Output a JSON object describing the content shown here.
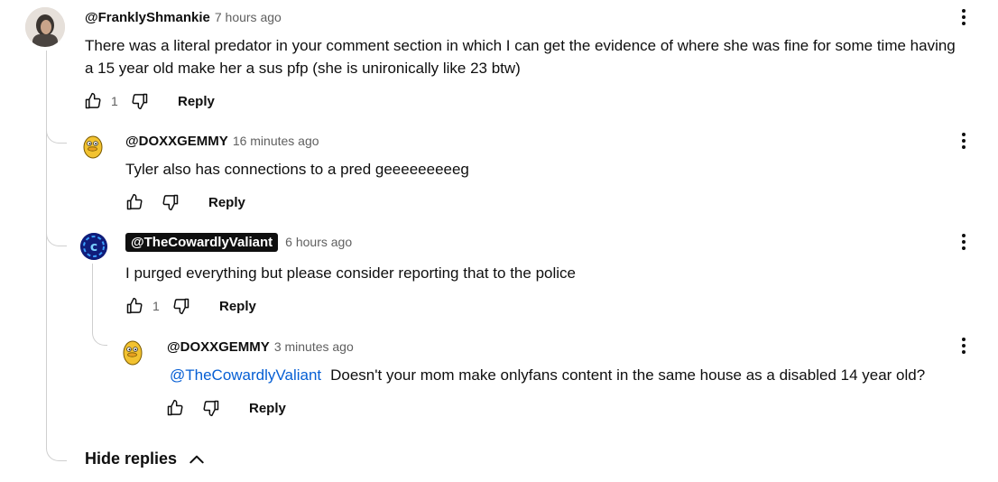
{
  "comments": [
    {
      "handle": "@FranklyShmankie",
      "time": "7 hours ago",
      "text_line1": "There was a literal predator in your comment section in which I can get the evidence of where she was fine for some time having",
      "text_line2": "a 15 year old make her a sus pfp (she is unironically like 23 btw)",
      "likes": "1",
      "reply_label": "Reply"
    },
    {
      "handle": "@DOXXGEMMY",
      "time": "16 minutes ago",
      "text": "Tyler also has connections to a pred geeeeeeeeeg",
      "likes": "",
      "reply_label": "Reply"
    },
    {
      "handle": "@TheCowardlyValiant",
      "time": "6 hours ago",
      "text": "I purged everything but please consider reporting that to the police",
      "likes": "1",
      "reply_label": "Reply"
    },
    {
      "handle": "@DOXXGEMMY",
      "time": "3 minutes ago",
      "mention": "@TheCowardlyValiant",
      "text": "Doesn't your mom make onlyfans content in the same house as a disabled 14 year old?",
      "likes": "",
      "reply_label": "Reply"
    }
  ],
  "hide_replies_label": "Hide replies",
  "icons": [
    "thumbs-up-icon",
    "thumbs-down-icon",
    "more-vert-icon",
    "chevron-up-icon"
  ],
  "colors": {
    "mention": "#065fd4",
    "owner_chip_bg": "#0f0f0f",
    "secondary_text": "#606060"
  }
}
